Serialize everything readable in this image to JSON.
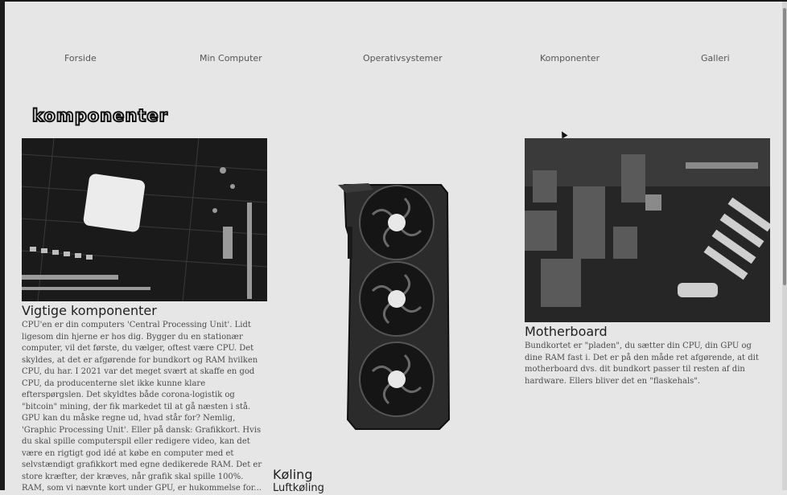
{
  "nav": {
    "items": [
      "Forside",
      "Min Computer",
      "Operativsystemer",
      "Komponenter",
      "Galleri"
    ]
  },
  "page": {
    "title": "Komponenter"
  },
  "sections": {
    "vigtige": {
      "heading": "Vigtige komponenter",
      "paragraph_1": "CPU'en er din computers 'Central Processing Unit'. Lidt ligesom din hjerne er hos dig. Bygger du en stationær computer, vil det første, du vælger, oftest være CPU. Det skyldes, at det er afgørende for bundkort og RAM hvilken CPU, du har. I 2021 var det meget svært at skaffe en god CPU, da producenterne slet ikke kunne klare efterspørgslen. Det skyldtes både corona-logistik og \"bitcoin\" mining, der fik markedet til at gå næsten i stå.",
      "paragraph_2": "GPU kan du måske regne ud, hvad står for? Nemlig, 'Graphic Processing Unit'. Eller på dansk: Grafikkort. Hvis du skal spille computerspil eller redigere video, kan det være en rigtigt god idé at købe en computer med et selvstændigt grafikkort med egne dedikerede RAM. Det er store kræfter, der kræves, når grafik skal spille 100%.",
      "paragraph_3": "RAM, som vi nævnte kort under GPU, er hukommelse for..."
    },
    "koeling": {
      "heading": "Køling",
      "subheading": "Luftkøling"
    },
    "motherboard": {
      "heading": "Motherboard",
      "paragraph": "Bundkortet er \"pladen\", du sætter din CPU, din GPU og dine RAM fast i. Det er på den måde ret afgørende, at dit motherboard dvs. dit bundkort passer til resten af din hardware. Ellers bliver det en \"flaskehals\"."
    }
  },
  "images": {
    "cpu": "cpu-photo",
    "gpu": "graphics-card-photo",
    "motherboard": "motherboard-photo"
  }
}
